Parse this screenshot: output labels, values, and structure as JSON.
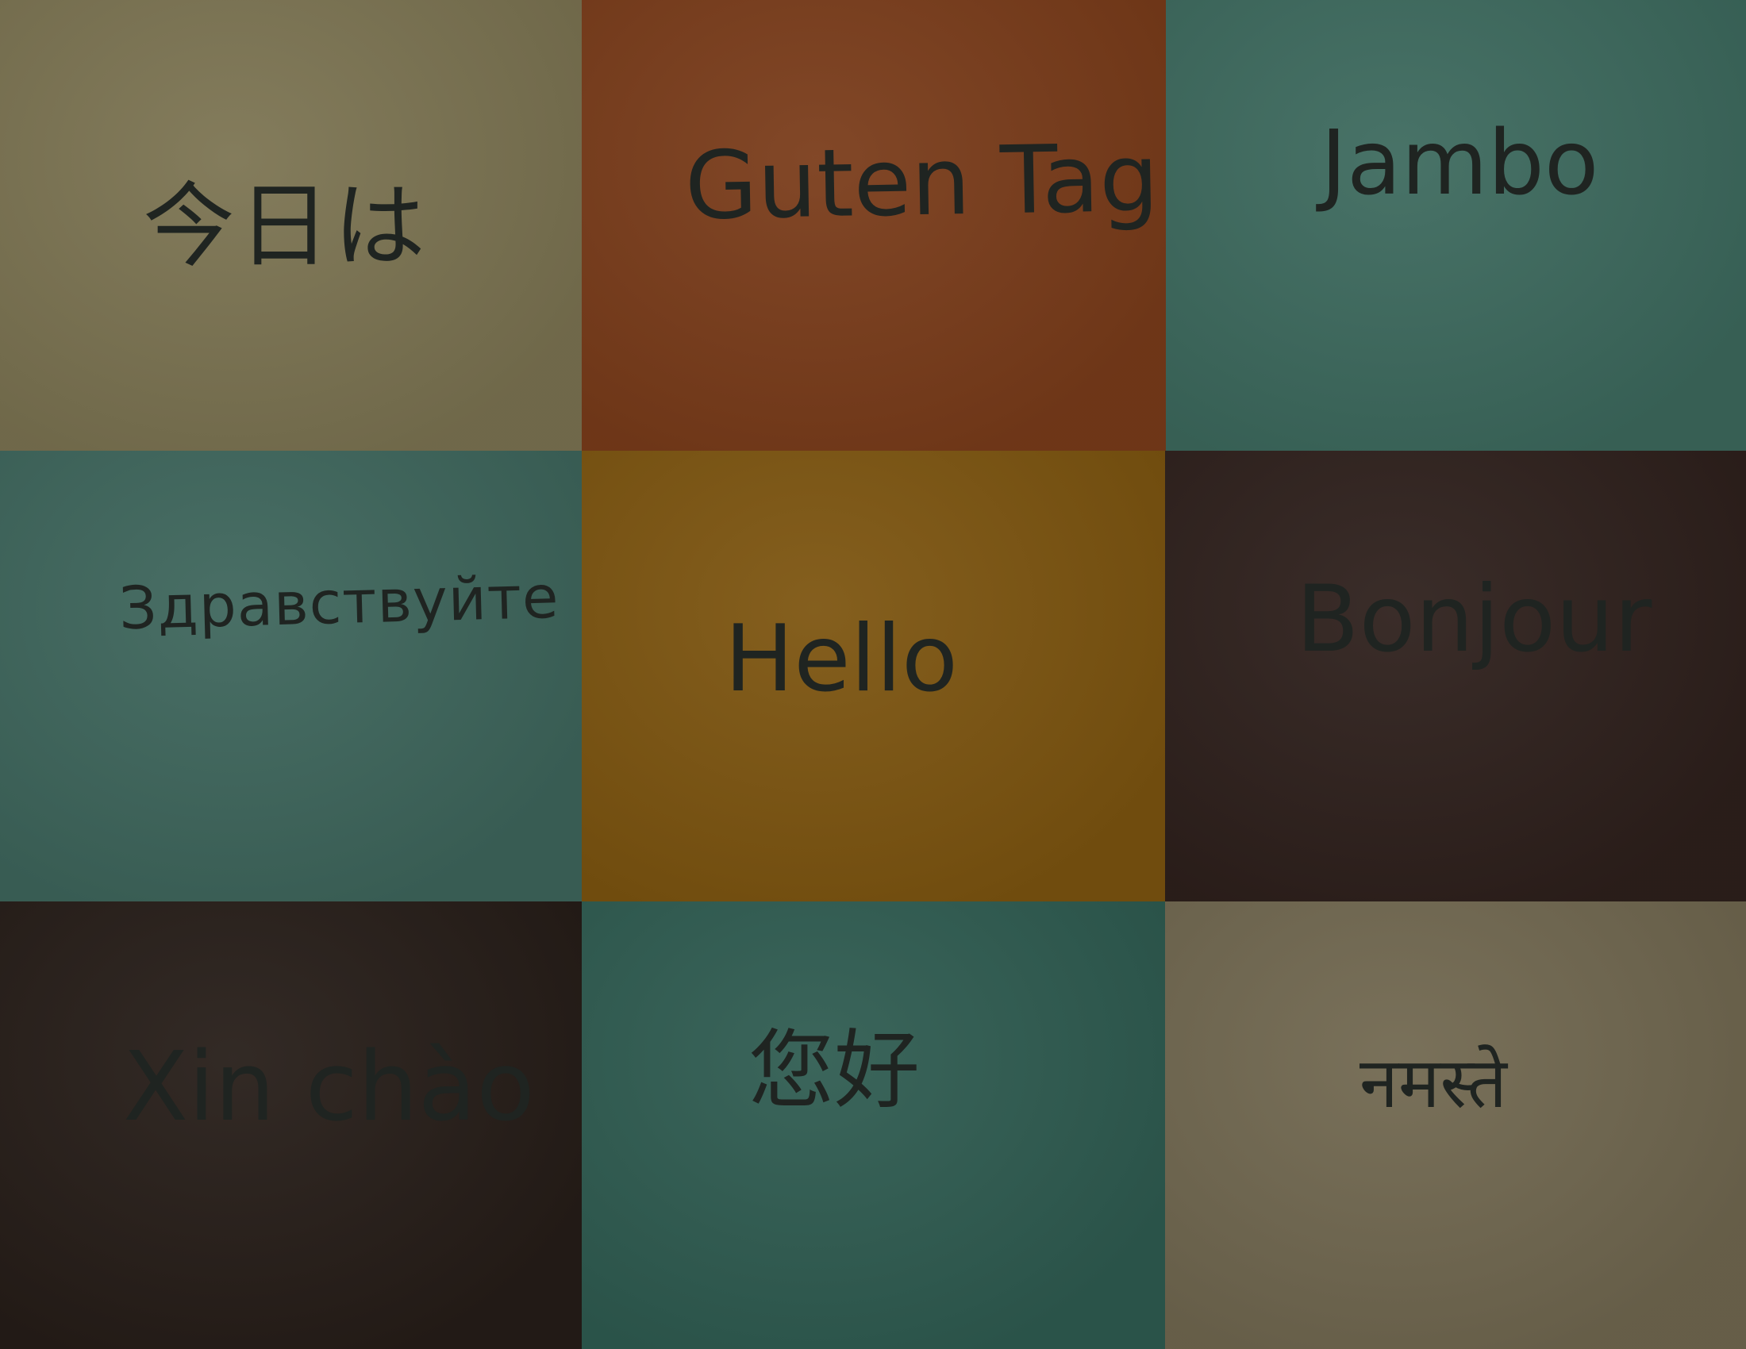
{
  "cards": [
    {
      "text": "今日は",
      "color": "#7c7452"
    },
    {
      "text": "Guten Tag",
      "color": "#7a3c1a"
    },
    {
      "text": "Jambo",
      "color": "#3d6a5e"
    },
    {
      "text": "Здравствуйте",
      "color": "#3e665c"
    },
    {
      "text": "Hello",
      "color": "#7d5510"
    },
    {
      "text": "Bonjour",
      "color": "#2e201c"
    },
    {
      "text": "Xin chào",
      "color": "#261d18"
    },
    {
      "text": "您好",
      "color": "#2f5c51"
    },
    {
      "text": "नमस्ते",
      "color": "#716850"
    }
  ],
  "ink_color": "#1f2421"
}
